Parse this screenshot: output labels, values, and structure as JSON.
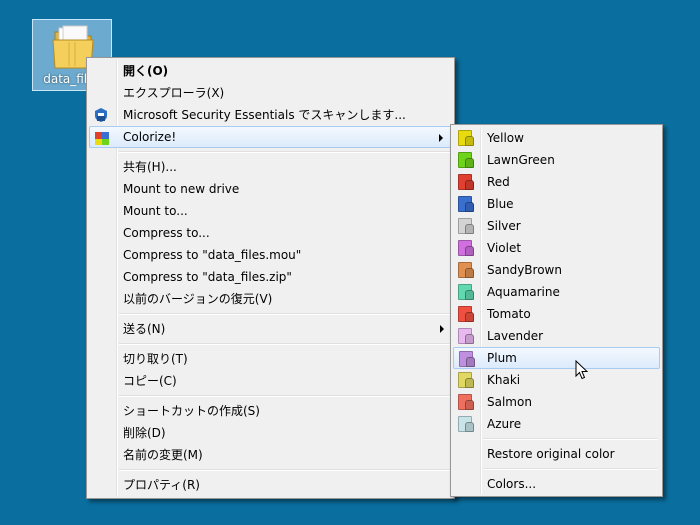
{
  "desktop": {
    "background": "#0a6f9f",
    "icon_label": "data_files"
  },
  "context_menu": {
    "items": [
      {
        "label": "開く(O)",
        "bold": true
      },
      {
        "label": "エクスプローラ(X)"
      },
      {
        "label": "Microsoft Security Essentials でスキャンします...",
        "icon": "shield-icon"
      },
      {
        "label": "Colorize!",
        "icon": "colorize-icon",
        "submenu": true,
        "highlighted": true
      },
      {
        "label": "共有(H)..."
      },
      {
        "label": "Mount to new drive"
      },
      {
        "label": "Mount to..."
      },
      {
        "label": "Compress to..."
      },
      {
        "label": "Compress to \"data_files.mou\""
      },
      {
        "label": "Compress to \"data_files.zip\""
      },
      {
        "label": "以前のバージョンの復元(V)"
      },
      {
        "label": "送る(N)",
        "submenu": true
      },
      {
        "label": "切り取り(T)"
      },
      {
        "label": "コピー(C)"
      },
      {
        "label": "ショートカットの作成(S)"
      },
      {
        "label": "削除(D)"
      },
      {
        "label": "名前の変更(M)"
      },
      {
        "label": "プロパティ(R)"
      }
    ]
  },
  "colorize_submenu": {
    "colors": [
      {
        "label": "Yellow",
        "color": "#e8dc10"
      },
      {
        "label": "LawnGreen",
        "color": "#6ed41a"
      },
      {
        "label": "Red",
        "color": "#e04030"
      },
      {
        "label": "Blue",
        "color": "#3a6fd0"
      },
      {
        "label": "Silver",
        "color": "#d4d4d4"
      },
      {
        "label": "Violet",
        "color": "#d070e0"
      },
      {
        "label": "SandyBrown",
        "color": "#e09050"
      },
      {
        "label": "Aquamarine",
        "color": "#60d8b0"
      },
      {
        "label": "Tomato",
        "color": "#f05040"
      },
      {
        "label": "Lavender",
        "color": "#e8b8f0"
      },
      {
        "label": "Plum",
        "color": "#c090e0"
      },
      {
        "label": "Khaki",
        "color": "#e0d860"
      },
      {
        "label": "Salmon",
        "color": "#f07060"
      },
      {
        "label": "Azure",
        "color": "#c8e4e8"
      }
    ],
    "highlighted": "Plum",
    "restore_label": "Restore original color",
    "more_label": "Colors..."
  }
}
